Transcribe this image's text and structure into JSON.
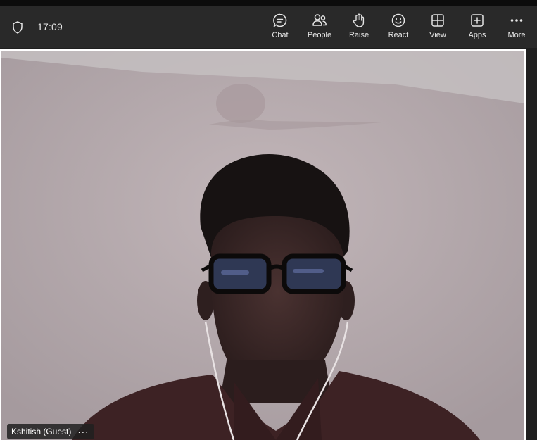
{
  "header": {
    "time": "17:09",
    "actions": [
      {
        "label": "Chat",
        "icon": "chat-icon"
      },
      {
        "label": "People",
        "icon": "people-icon"
      },
      {
        "label": "Raise",
        "icon": "raise-hand-icon"
      },
      {
        "label": "React",
        "icon": "smiley-icon"
      },
      {
        "label": "View",
        "icon": "grid-view-icon"
      },
      {
        "label": "Apps",
        "icon": "add-app-icon"
      },
      {
        "label": "More",
        "icon": "more-icon"
      }
    ]
  },
  "participant": {
    "name": "Kshitish (Guest)",
    "options_glyph": "···"
  },
  "colors": {
    "toolbar_bg": "#292929",
    "page_bg": "#1f1f1f",
    "video_frame_border": "#ffffff"
  }
}
